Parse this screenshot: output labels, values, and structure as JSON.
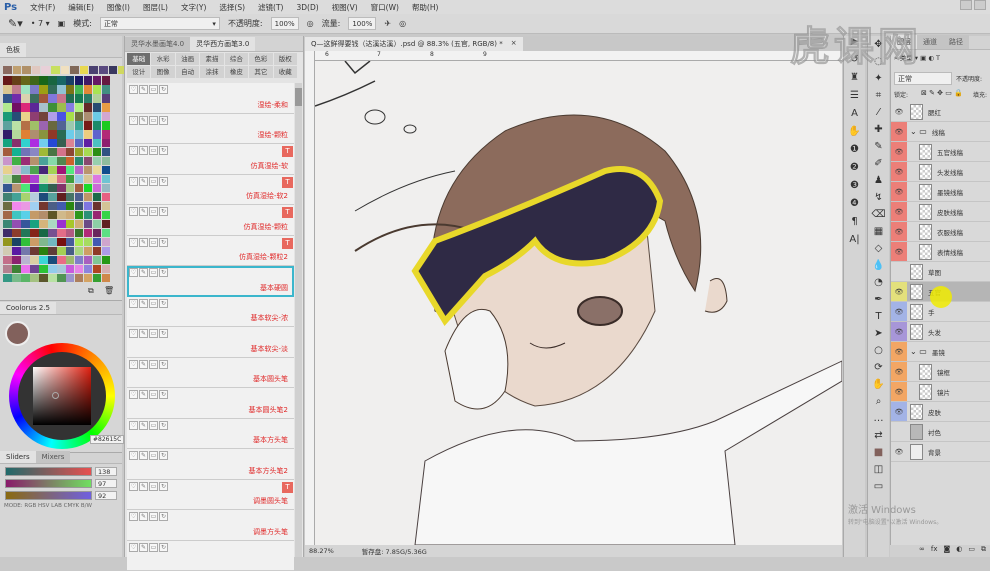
{
  "app": {
    "logo": "Ps"
  },
  "menu": [
    "文件(F)",
    "编辑(E)",
    "图像(I)",
    "图层(L)",
    "文字(Y)",
    "选择(S)",
    "滤镜(T)",
    "3D(D)",
    "视图(V)",
    "窗口(W)",
    "帮助(H)"
  ],
  "options": {
    "brush_size": "7",
    "mode_label": "模式:",
    "mode_value": "正常",
    "opacity_label": "不透明度:",
    "opacity_value": "100%",
    "flow_label": "流量:",
    "flow_value": "100%"
  },
  "swatches": {
    "title": "色板",
    "recent": [
      "#8a6a60",
      "#c0a070",
      "#b09068",
      "#e0c8c0",
      "#e8d0d8",
      "#c8e060",
      "#f0e0c0",
      "#806858",
      "#e8d850",
      "#4a4070",
      "#5a4a80",
      "#3a3860",
      "#d0d860"
    ]
  },
  "coolorus": {
    "title": "Coolorus 2.5",
    "current_color": "#82615C",
    "hex": "82615C"
  },
  "sliders": {
    "tabs": [
      "Sliders",
      "Mixers"
    ],
    "values": [
      "138",
      "97",
      "92"
    ],
    "modes": "MODE: RGB HSV LAB CMYK B/W"
  },
  "brush_panel": {
    "tabs": [
      "灵华水墨画笔4.0",
      "灵华西方画笔3.0"
    ],
    "categories": [
      "基础",
      "水彩",
      "油画",
      "素描",
      "综合",
      "色彩",
      "版权",
      "设计",
      "图像",
      "自动",
      "涂抹",
      "橡皮",
      "其它",
      "收藏"
    ],
    "brushes": [
      {
        "label": "湿绘-柔和",
        "t": false
      },
      {
        "label": "湿绘-颗粒",
        "t": false
      },
      {
        "label": "仿真湿绘-软",
        "t": true
      },
      {
        "label": "仿真湿绘-软2",
        "t": true
      },
      {
        "label": "仿真湿绘-颗粒",
        "t": true
      },
      {
        "label": "仿真湿绘-颗粒2",
        "t": true
      },
      {
        "label": "基本硬圆",
        "t": false,
        "selected": true
      },
      {
        "label": "基本软尖-浓",
        "t": false
      },
      {
        "label": "基本软尖-淡",
        "t": false
      },
      {
        "label": "基本圆头笔",
        "t": false
      },
      {
        "label": "基本圆头笔2",
        "t": false
      },
      {
        "label": "基本方头笔",
        "t": false
      },
      {
        "label": "基本方头笔2",
        "t": false
      },
      {
        "label": "调墨圆头笔",
        "t": true
      },
      {
        "label": "调墨方头笔",
        "t": false
      },
      {
        "label": "",
        "t": false
      }
    ],
    "t_badge": "T"
  },
  "document": {
    "tab_title": "Q—这鲜得要钱（达溪达溪）.psd @ 88.3% (五官, RGB/8) *",
    "close": "×",
    "ruler_ticks": [
      "6",
      "7",
      "8",
      "9"
    ],
    "zoom": "88.27%",
    "scratch": "暂存盘: 7.85G/5.36G"
  },
  "layers_panel": {
    "tabs": [
      "图层",
      "通道",
      "路径"
    ],
    "filter": "类型",
    "blend": "正常",
    "opacity_label": "不透明度:",
    "lock_label": "锁定:",
    "fill_label": "填充:",
    "layers": [
      {
        "name": "腮红",
        "color": "",
        "indent": 0,
        "visible": true
      },
      {
        "name": "线稿",
        "color": "#ec7f78",
        "indent": 0,
        "group": true,
        "visible": true
      },
      {
        "name": "五官线稿",
        "color": "#ec7f78",
        "indent": 1,
        "visible": true
      },
      {
        "name": "头发线稿",
        "color": "#ec7f78",
        "indent": 1,
        "visible": true
      },
      {
        "name": "墨镜线稿",
        "color": "#ec7f78",
        "indent": 1,
        "visible": true
      },
      {
        "name": "皮肤线稿",
        "color": "#ec7f78",
        "indent": 1,
        "visible": true
      },
      {
        "name": "衣服线稿",
        "color": "#ec7f78",
        "indent": 1,
        "visible": true
      },
      {
        "name": "表情线稿",
        "color": "#ec7f78",
        "indent": 1,
        "visible": true
      },
      {
        "name": "草图",
        "color": "",
        "indent": 0,
        "visible": false
      },
      {
        "name": "五官",
        "color": "#e3e07c",
        "indent": 0,
        "visible": true,
        "selected": true
      },
      {
        "name": "手",
        "color": "#a3b3e6",
        "indent": 0,
        "visible": true
      },
      {
        "name": "头发",
        "color": "#a796d8",
        "indent": 0,
        "visible": true
      },
      {
        "name": "墨镜",
        "color": "#f2a664",
        "indent": 0,
        "group": true,
        "visible": true
      },
      {
        "name": "镜框",
        "color": "#f2a664",
        "indent": 1,
        "visible": true
      },
      {
        "name": "镜片",
        "color": "#f2a664",
        "indent": 1,
        "visible": true
      },
      {
        "name": "皮肤",
        "color": "#a3b3e6",
        "indent": 0,
        "visible": true
      },
      {
        "name": "衬色",
        "color": "",
        "indent": 0,
        "visible": false
      },
      {
        "name": "背景",
        "color": "",
        "indent": 0,
        "visible": true
      }
    ]
  },
  "watermark": "虎课网",
  "activate": {
    "title": "激活 Windows",
    "sub": "转到\"电脑设置\"以激活 Windows。"
  }
}
